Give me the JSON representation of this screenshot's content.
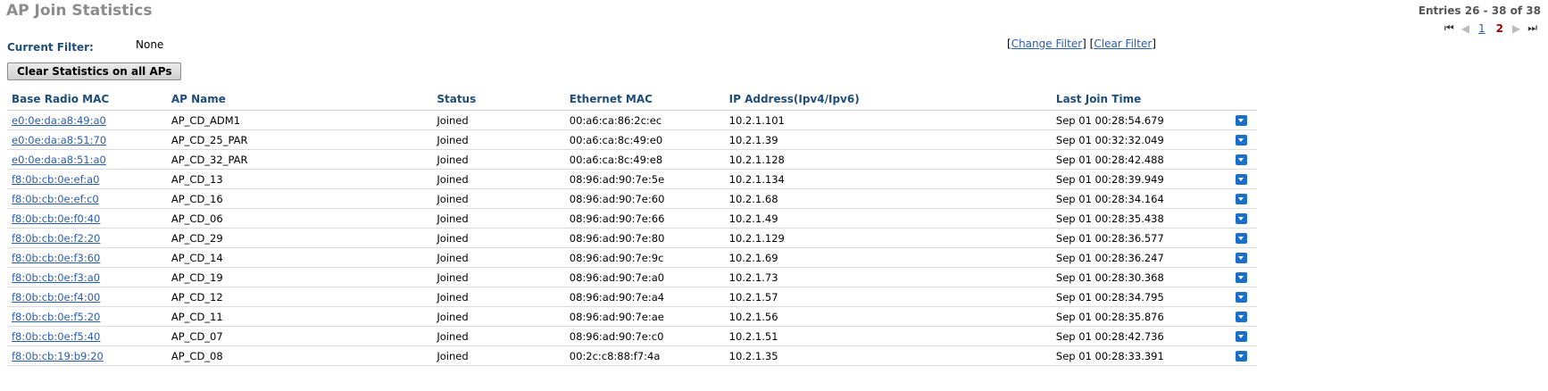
{
  "title": "AP Join Statistics",
  "entries_text": "Entries 26 - 38 of 38",
  "pagination": {
    "pages": [
      "1",
      "2"
    ],
    "current": "2"
  },
  "filter": {
    "label": "Current Filter:",
    "value": "None",
    "change_label": "Change Filter",
    "clear_label": "Clear Filter"
  },
  "clear_button": "Clear Statistics on all APs",
  "columns": [
    "Base Radio MAC",
    "AP Name",
    "Status",
    "Ethernet MAC",
    "IP Address(Ipv4/Ipv6)",
    "Last Join Time"
  ],
  "rows": [
    {
      "mac": "e0:0e:da:a8:49:a0",
      "name": "AP_CD_ADM1",
      "status": "Joined",
      "eth": "00:a6:ca:86:2c:ec",
      "ip": "10.2.1.101",
      "time": "Sep 01 00:28:54.679"
    },
    {
      "mac": "e0:0e:da:a8:51:70",
      "name": "AP_CD_25_PAR",
      "status": "Joined",
      "eth": "00:a6:ca:8c:49:e0",
      "ip": "10.2.1.39",
      "time": "Sep 01 00:32:32.049"
    },
    {
      "mac": "e0:0e:da:a8:51:a0",
      "name": "AP_CD_32_PAR",
      "status": "Joined",
      "eth": "00:a6:ca:8c:49:e8",
      "ip": "10.2.1.128",
      "time": "Sep 01 00:28:42.488"
    },
    {
      "mac": "f8:0b:cb:0e:ef:a0",
      "name": "AP_CD_13",
      "status": "Joined",
      "eth": "08:96:ad:90:7e:5e",
      "ip": "10.2.1.134",
      "time": "Sep 01 00:28:39.949"
    },
    {
      "mac": "f8:0b:cb:0e:ef:c0",
      "name": "AP_CD_16",
      "status": "Joined",
      "eth": "08:96:ad:90:7e:60",
      "ip": "10.2.1.68",
      "time": "Sep 01 00:28:34.164"
    },
    {
      "mac": "f8:0b:cb:0e:f0:40",
      "name": "AP_CD_06",
      "status": "Joined",
      "eth": "08:96:ad:90:7e:66",
      "ip": "10.2.1.49",
      "time": "Sep 01 00:28:35.438"
    },
    {
      "mac": "f8:0b:cb:0e:f2:20",
      "name": "AP_CD_29",
      "status": "Joined",
      "eth": "08:96:ad:90:7e:80",
      "ip": "10.2.1.129",
      "time": "Sep 01 00:28:36.577"
    },
    {
      "mac": "f8:0b:cb:0e:f3:60",
      "name": "AP_CD_14",
      "status": "Joined",
      "eth": "08:96:ad:90:7e:9c",
      "ip": "10.2.1.69",
      "time": "Sep 01 00:28:36.247"
    },
    {
      "mac": "f8:0b:cb:0e:f3:a0",
      "name": "AP_CD_19",
      "status": "Joined",
      "eth": "08:96:ad:90:7e:a0",
      "ip": "10.2.1.73",
      "time": "Sep 01 00:28:30.368"
    },
    {
      "mac": "f8:0b:cb:0e:f4:00",
      "name": "AP_CD_12",
      "status": "Joined",
      "eth": "08:96:ad:90:7e:a4",
      "ip": "10.2.1.57",
      "time": "Sep 01 00:28:34.795"
    },
    {
      "mac": "f8:0b:cb:0e:f5:20",
      "name": "AP_CD_11",
      "status": "Joined",
      "eth": "08:96:ad:90:7e:ae",
      "ip": "10.2.1.56",
      "time": "Sep 01 00:28:35.876"
    },
    {
      "mac": "f8:0b:cb:0e:f5:40",
      "name": "AP_CD_07",
      "status": "Joined",
      "eth": "08:96:ad:90:7e:c0",
      "ip": "10.2.1.51",
      "time": "Sep 01 00:28:42.736"
    },
    {
      "mac": "f8:0b:cb:19:b9:20",
      "name": "AP_CD_08",
      "status": "Joined",
      "eth": "00:2c:c8:88:f7:4a",
      "ip": "10.2.1.35",
      "time": "Sep 01 00:28:33.391"
    }
  ]
}
